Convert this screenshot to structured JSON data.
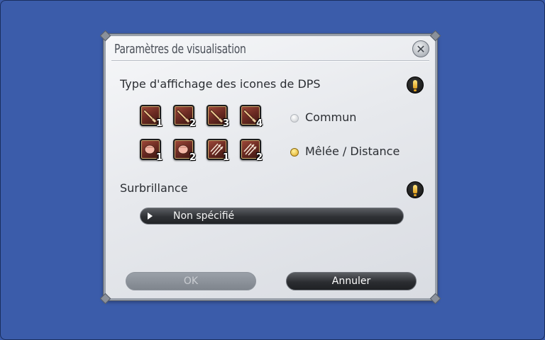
{
  "dialog": {
    "title": "Paramètres de visualisation",
    "close_icon": "close-icon"
  },
  "dps_section": {
    "label": "Type d'affichage des icones de DPS",
    "info_icon": "warning-icon",
    "row1_icons": [
      {
        "icon": "sword-icon",
        "number": "1"
      },
      {
        "icon": "sword-icon",
        "number": "2"
      },
      {
        "icon": "sword-icon",
        "number": "3"
      },
      {
        "icon": "sword-icon",
        "number": "4"
      }
    ],
    "row2_icons": [
      {
        "icon": "fist-icon",
        "number": "1"
      },
      {
        "icon": "fist-icon",
        "number": "2"
      },
      {
        "icon": "arrows-icon",
        "number": "1"
      },
      {
        "icon": "arrows-icon",
        "number": "2"
      }
    ],
    "options": [
      {
        "label": "Commun",
        "selected": false
      },
      {
        "label": "Mêlée / Distance",
        "selected": true
      }
    ]
  },
  "highlight_section": {
    "label": "Surbrillance",
    "info_icon": "warning-icon",
    "dropdown_value": "Non spécifié"
  },
  "buttons": {
    "ok_label": "OK",
    "ok_enabled": false,
    "cancel_label": "Annuler"
  },
  "colors": {
    "background": "#3a5aa8",
    "selected_radio": "#e0a51c",
    "icon_frame": "#6b2a22"
  }
}
